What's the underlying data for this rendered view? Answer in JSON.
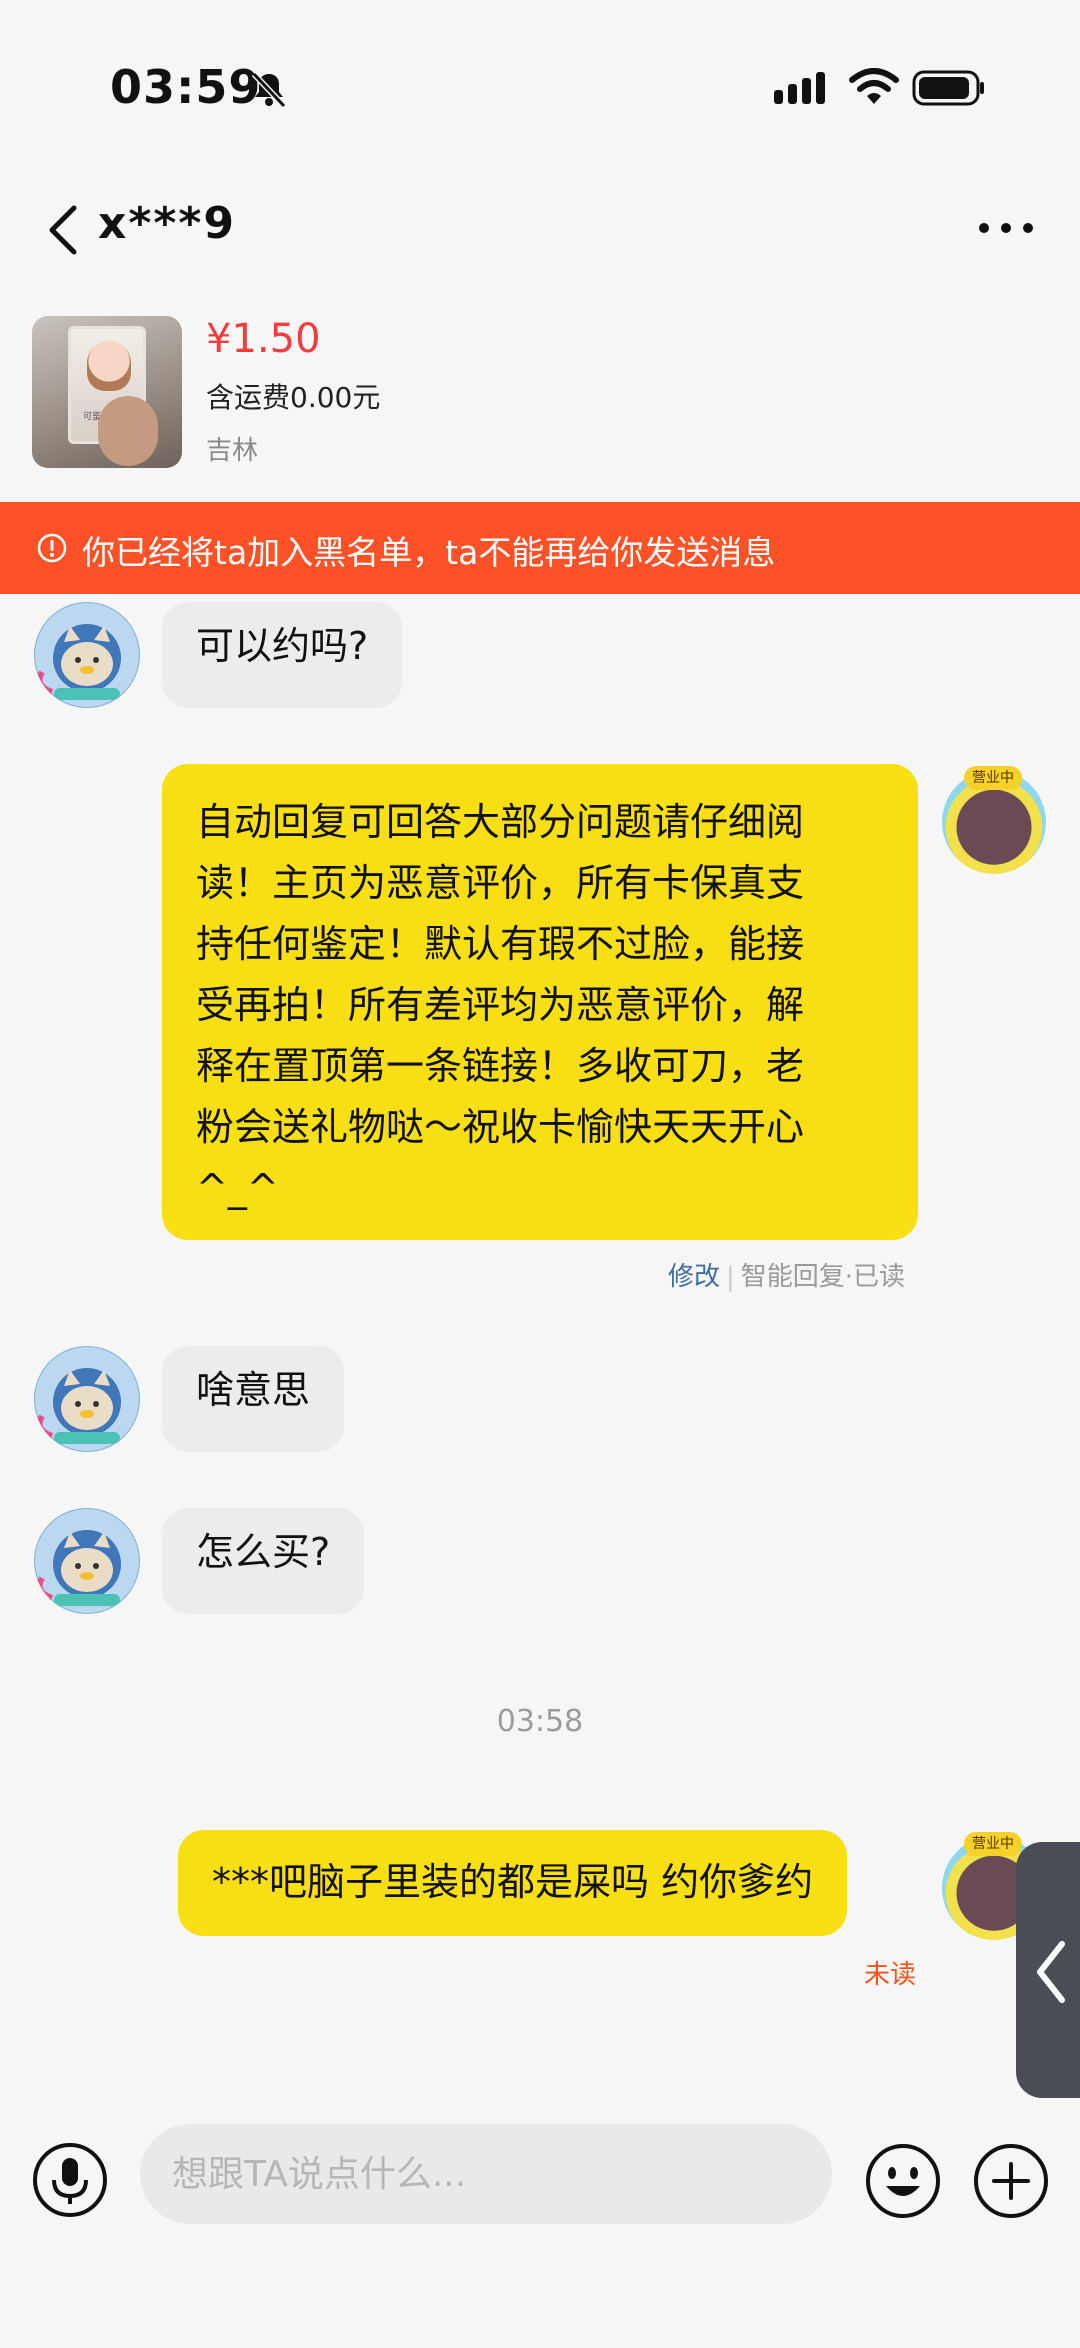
{
  "status_bar": {
    "time": "03:59",
    "icons": [
      "bell-muted-icon",
      "signal-icon",
      "wifi-icon",
      "battery-icon"
    ]
  },
  "header": {
    "title": "x***9",
    "icons": [
      "back-icon",
      "more-icon"
    ]
  },
  "product": {
    "price": "¥1.50",
    "shipping": "含运费0.00元",
    "location": "吉林",
    "thumb_text": "可鉴定"
  },
  "banner": {
    "text": "你已经将ta加入黑名单，ta不能再给你发送消息",
    "icon": "warning-icon"
  },
  "messages": [
    {
      "from": "other",
      "text": "可以约吗?"
    },
    {
      "from": "self",
      "lines": [
        "自动回复可回答大部分问题请仔细阅",
        "读！主页为恶意评价，所有卡保真支",
        "持任何鉴定！默认有瑕不过脸，能接",
        "受再拍！所有差评均为恶意评价，解",
        "释在置顶第一条链接！多收可刀，老",
        "粉会送礼物哒～祝收卡愉快天天开心",
        "^_^"
      ],
      "meta_edit": "修改",
      "meta_status": "智能回复·已读"
    },
    {
      "from": "other",
      "text": "啥意思"
    },
    {
      "from": "other",
      "text": "怎么买?"
    },
    {
      "from": "self",
      "text": "***吧脑子里装的都是屎吗 约你爹约",
      "status": "未读"
    }
  ],
  "self_badge": "营业中",
  "timestamp": "03:58",
  "input": {
    "placeholder": "想跟TA说点什么..."
  },
  "colors": {
    "price": "#f23d3d",
    "banner": "#fd5228",
    "outgoing_bubble": "#f7df13",
    "incoming_bubble": "#ececec",
    "unread": "#f0541e",
    "edit_link": "#3a6ea5"
  }
}
